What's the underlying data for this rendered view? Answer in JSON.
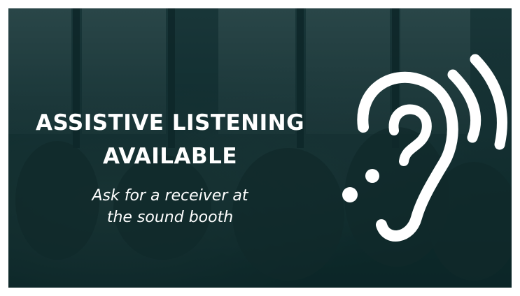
{
  "banner": {
    "headline_line1": "ASSISTIVE LISTENING",
    "headline_line2": "AVAILABLE",
    "subtext_line1": "Ask for a receiver at",
    "subtext_line2": "the sound booth",
    "icon": "ear-with-sound-waves-icon",
    "colors": {
      "overlay": "#0a2628",
      "text": "#ffffff"
    }
  }
}
